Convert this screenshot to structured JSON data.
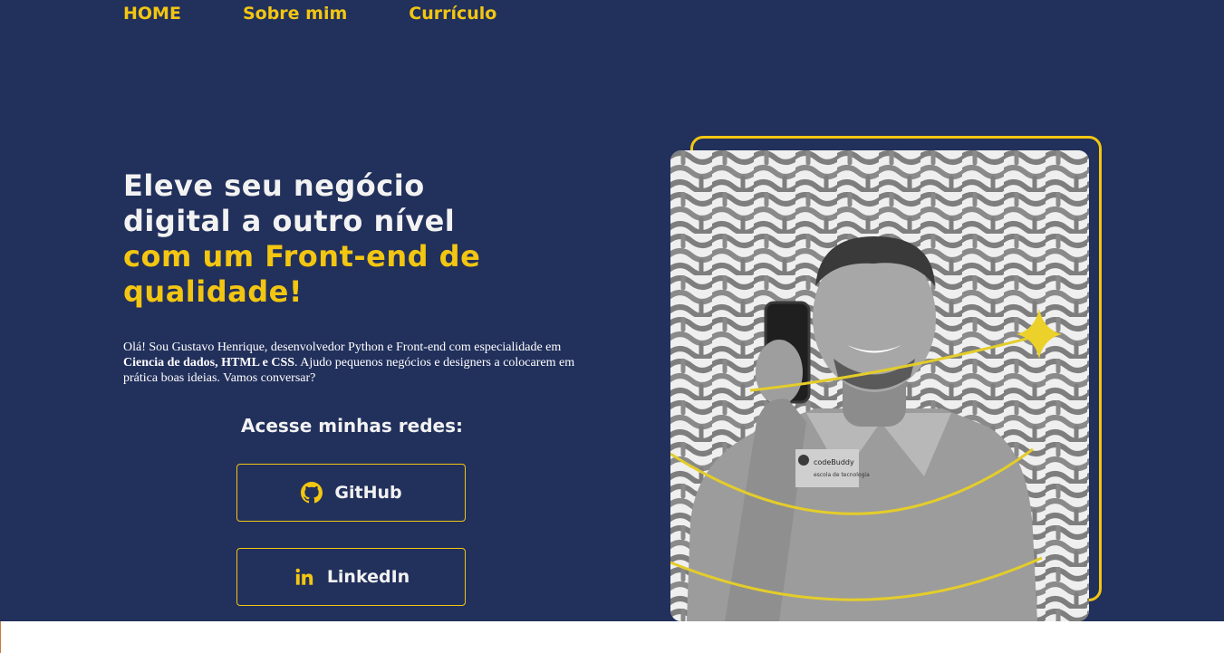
{
  "nav": {
    "items": [
      {
        "label": "HOME"
      },
      {
        "label": "Sobre mim"
      },
      {
        "label": "Currículo"
      }
    ]
  },
  "hero": {
    "title_white_1": "Eleve seu negócio",
    "title_white_2": "digital a outro nível",
    "title_yellow_1": "com um Front-end de",
    "title_yellow_2": "qualidade!",
    "intro_1": "Olá! Sou Gustavo Henrique, desenvolvedor Python e Front-end com especialidade em ",
    "intro_bold": "Ciencia de dados, HTML e CSS",
    "intro_2": ". Ajudo pequenos negócios e designers a colocarem em prática boas ideias. Vamos conversar?"
  },
  "networks": {
    "title": "Acesse minhas redes:",
    "github_label": "GitHub",
    "linkedin_label": "LinkedIn"
  },
  "photo": {
    "shirt_brand": "codeBuddy",
    "shirt_tagline": "escola de tecnologia"
  },
  "colors": {
    "background": "#22305c",
    "accent": "#f2c611",
    "text": "#f2f2f2"
  },
  "icons": {
    "github": "github-icon",
    "linkedin": "linkedin-icon",
    "sparkle": "sparkle-icon"
  }
}
